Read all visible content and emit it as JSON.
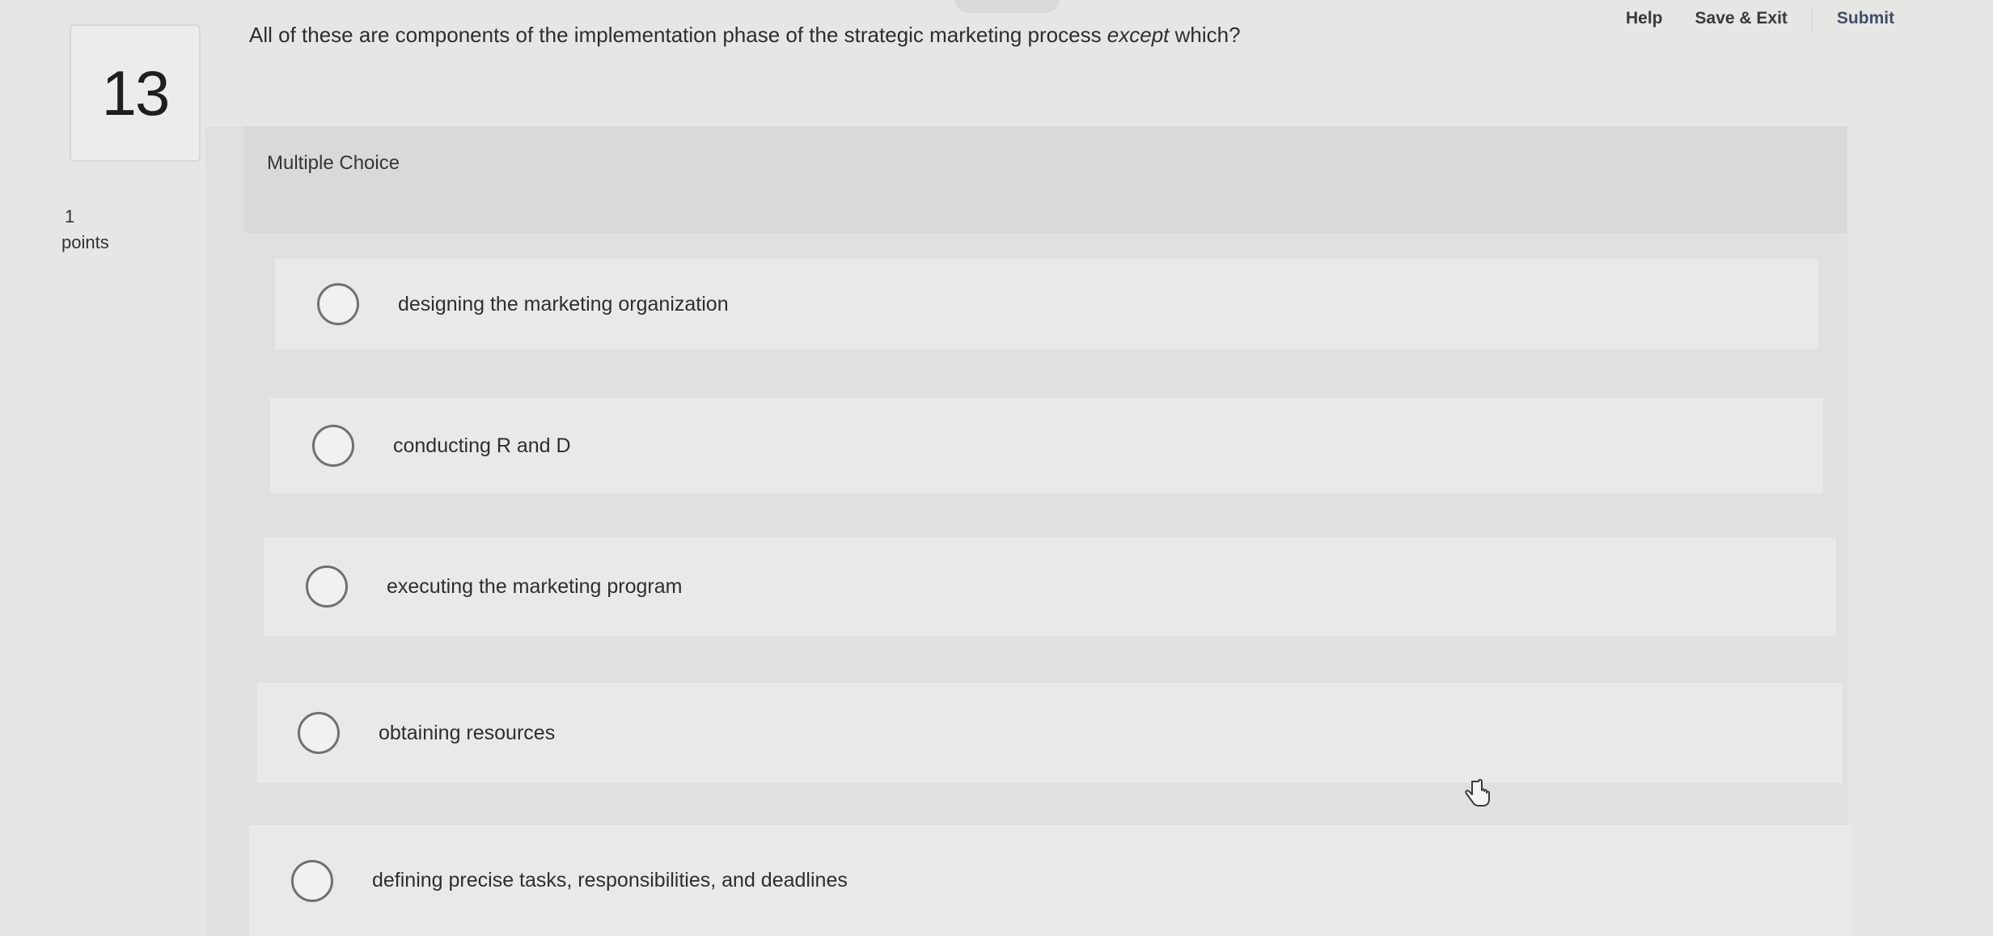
{
  "header": {
    "help_label": "Help",
    "save_exit_label": "Save & Exit",
    "submit_label": "Submit"
  },
  "question": {
    "number": "13",
    "points_value": "1",
    "points_label": "points",
    "text_before": "All of these are components of the implementation phase of the strategic marketing process ",
    "text_emphasis": "except",
    "text_after": " which?",
    "type_label": "Multiple Choice"
  },
  "options": [
    {
      "label": "designing the marketing organization"
    },
    {
      "label": "conducting R and D"
    },
    {
      "label": "executing the marketing program"
    },
    {
      "label": "obtaining resources"
    },
    {
      "label": "defining precise tasks, responsibilities, and deadlines"
    }
  ],
  "icons": {
    "radio": "radio-unselected-icon",
    "cursor": "hand-pointer-icon"
  }
}
